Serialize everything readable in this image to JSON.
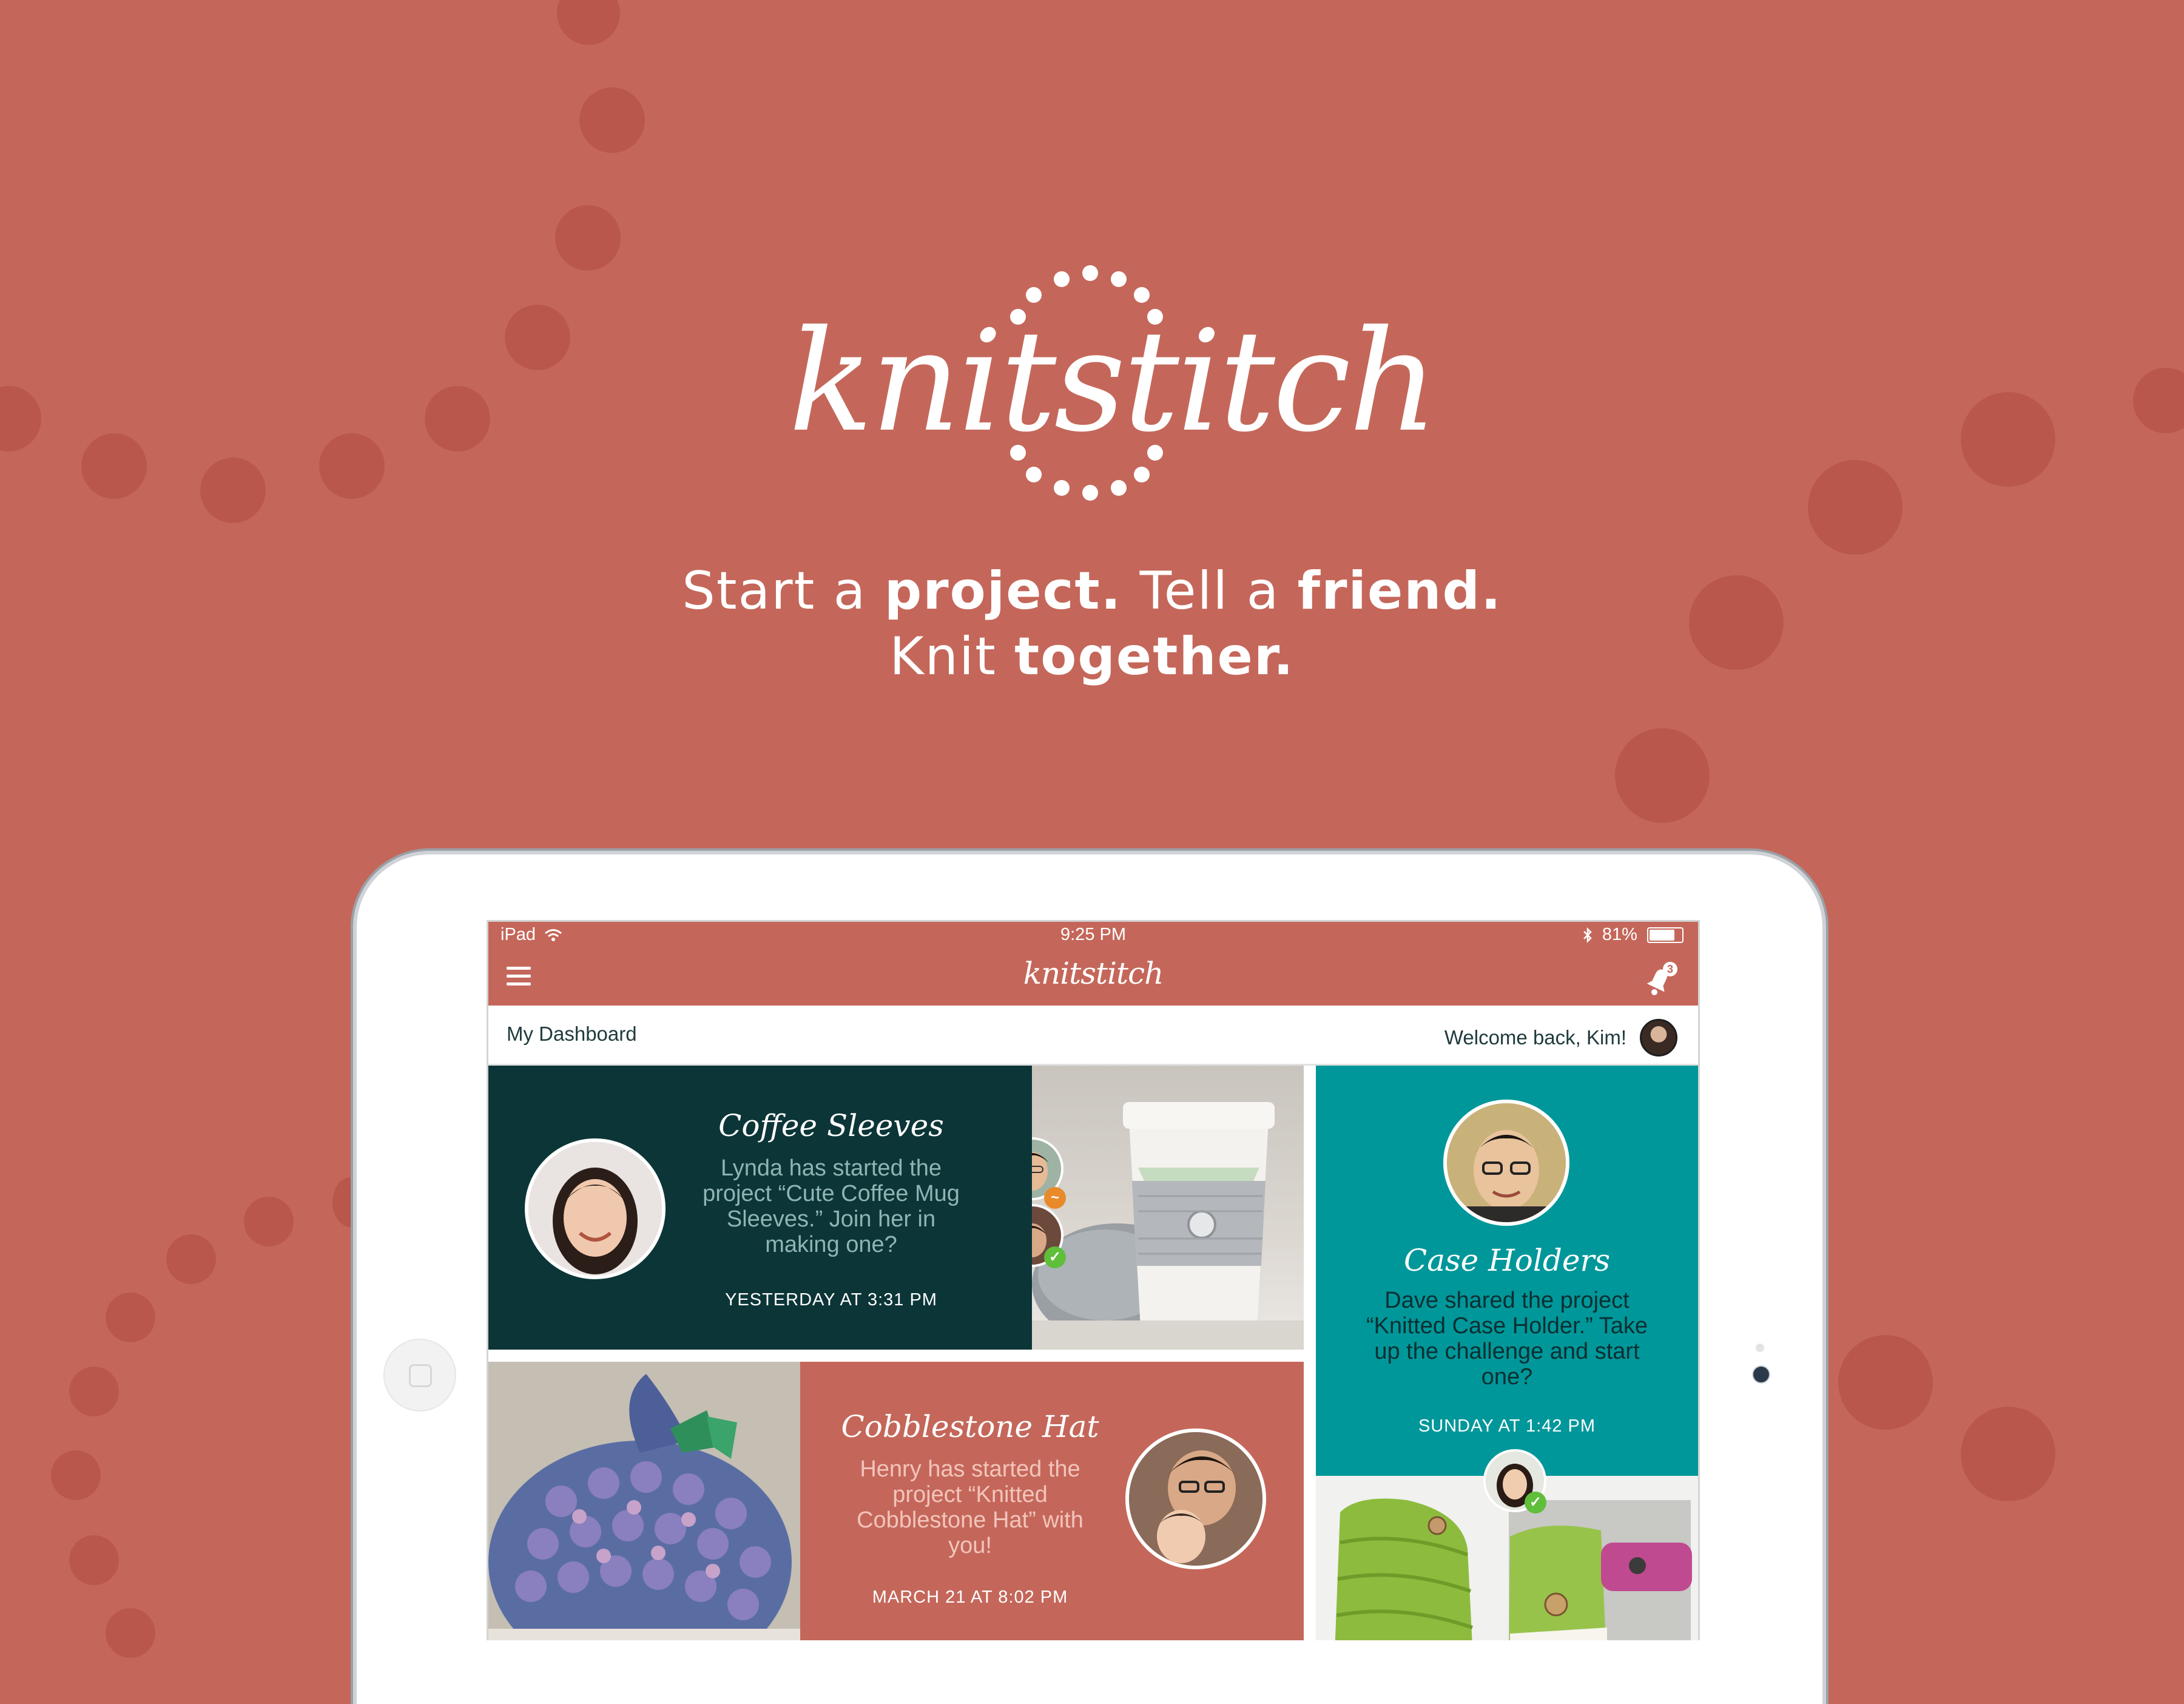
{
  "brand": {
    "logo_text": "knitstitch",
    "accent": "#c4675a",
    "dark_teal": "#0c3537",
    "teal": "#00979a"
  },
  "tagline": {
    "line1_a": "Start a ",
    "line1_b": "project.",
    "line1_c": " Tell a ",
    "line1_d": "friend.",
    "line2_a": "Knit ",
    "line2_b": "together."
  },
  "statusbar": {
    "device": "iPad",
    "time": "9:25 PM",
    "battery": "81%",
    "battery_level": 0.81,
    "bluetooth_icon": "bluetooth-icon",
    "wifi_icon": "wifi-icon"
  },
  "navbar": {
    "logo_text": "knitstitch",
    "notification_count": "3"
  },
  "subheader": {
    "title": "My Dashboard",
    "welcome": "Welcome back, Kim!"
  },
  "cards": [
    {
      "title": "Coffee Sleeves",
      "description": "Lynda has started the project “Cute Coffee Mug Sleeves.” Join her in making one?",
      "time": "YESTERDAY AT 3:31 PM"
    },
    {
      "title": "Case Holders",
      "description": "Dave shared the project “Knitted Case Holder.” Take up the challenge and start one?",
      "time": "SUNDAY AT 1:42 PM"
    },
    {
      "title": "Cobblestone Hat",
      "description": "Henry has started the project “Knitted Cobblestone Hat” with you!",
      "time": "MARCH 21 AT 8:02 PM"
    }
  ]
}
